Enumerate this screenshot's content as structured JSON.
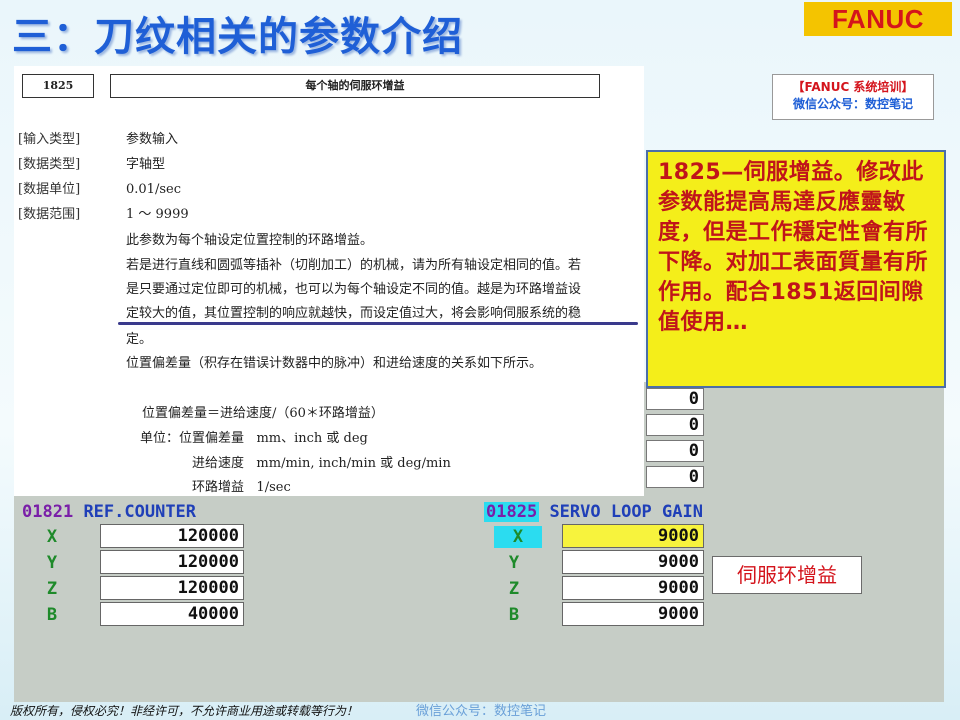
{
  "header": {
    "title": "三：刀纹相关的参数介绍",
    "logo": "FANUC"
  },
  "watermark": {
    "line1": "【FANUC 系统培训】",
    "line2": "微信公众号：数控笔记"
  },
  "doc": {
    "param_number": "1825",
    "param_name": "每个轴的伺服环增益",
    "fields": [
      {
        "key": "[输入类型]",
        "value": "参数输入"
      },
      {
        "key": "[数据类型]",
        "value": "字轴型"
      },
      {
        "key": "[数据单位]",
        "value": "0.01/sec"
      },
      {
        "key": "[数据范围]",
        "value": "1 ～ 9999"
      }
    ],
    "paragraphs": [
      "此参数为每个轴设定位置控制的环路增益。",
      "若是进行直线和圆弧等插补（切削加工）的机械，请为所有轴设定相同的值。若",
      "是只要通过定位即可的机械，也可以为每个轴设定不同的值。越是为环路增益设",
      "定较大的值，其位置控制的响应就越快，而设定值过大，将会影响伺服系统的稳",
      "定。",
      "位置偏差量（积存在错误计数器中的脉冲）和进给速度的关系如下所示。"
    ],
    "formula": "位置偏差量＝进给速度/（60＊环路增益）",
    "unit_label": "单位：",
    "units": [
      {
        "name": "位置偏差量",
        "unit": "mm、inch 或 deg"
      },
      {
        "name": "进给速度",
        "unit": "mm/min, inch/min  或 deg/min"
      },
      {
        "name": "环路增益",
        "unit": "1/sec"
      }
    ]
  },
  "cnc": {
    "side_values": [
      "0",
      "0",
      "0",
      "0"
    ],
    "left": {
      "number": "01821",
      "name": "REF.COUNTER",
      "rows": [
        {
          "axis": "X",
          "value": "120000"
        },
        {
          "axis": "Y",
          "value": "120000"
        },
        {
          "axis": "Z",
          "value": "120000"
        },
        {
          "axis": "B",
          "value": "40000"
        }
      ]
    },
    "right": {
      "number": "01825",
      "name": "SERVO LOOP GAIN",
      "rows": [
        {
          "axis": "X",
          "value": "9000"
        },
        {
          "axis": "Y",
          "value": "9000"
        },
        {
          "axis": "Z",
          "value": "9000"
        },
        {
          "axis": "B",
          "value": "9000"
        }
      ]
    }
  },
  "callout": {
    "text": "1825—伺服增益。修改此参数能提高馬達反應靈敏度，但是工作穩定性會有所下降。对加工表面質量有所作用。配合1851返回间隙值使用…"
  },
  "label_box": "伺服环增益",
  "footer": {
    "left": "版权所有，侵权必究！非经许可，不允许商业用途或转载等行为！",
    "right": "微信公众号：数控笔记"
  }
}
